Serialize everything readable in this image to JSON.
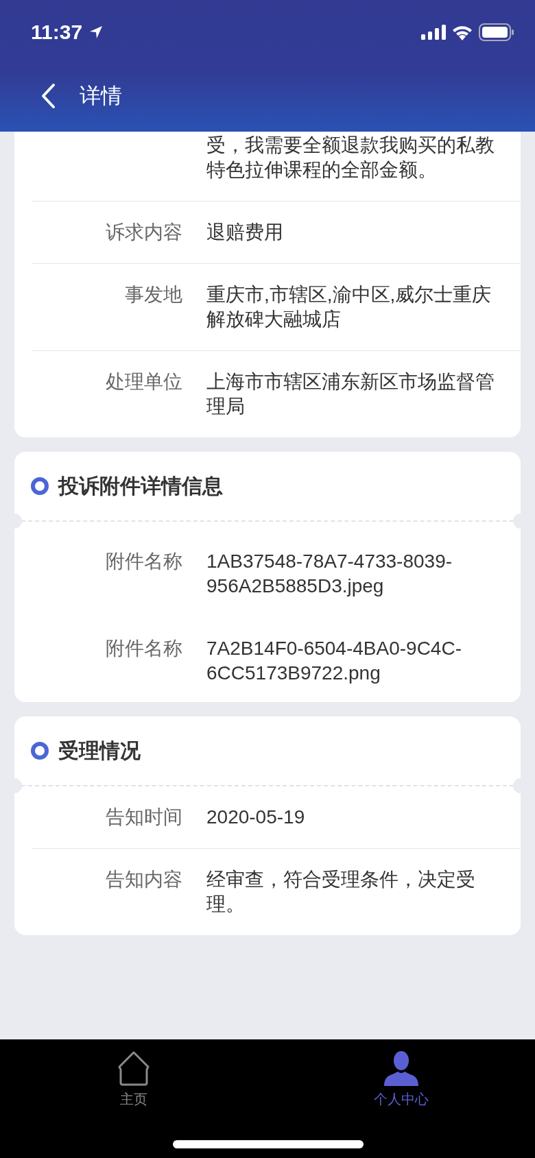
{
  "status_bar": {
    "time": "11:37"
  },
  "nav_bar": {
    "title": "详情"
  },
  "sections": [
    {
      "rows": [
        {
          "label": null,
          "value": "受，我需要全额退款我购买的私教特色拉伸课程的全部金额。"
        },
        {
          "label": "诉求内容",
          "value": "退赔费用"
        },
        {
          "label": "事发地",
          "value": "重庆市,市辖区,渝中区,威尔士重庆解放碑大融城店"
        },
        {
          "label": "处理单位",
          "value": "上海市市辖区浦东新区市场监督管理局"
        }
      ],
      "dividers": true
    },
    {
      "title": "投诉附件详情信息",
      "rows": [
        {
          "label": "附件名称",
          "value": "1AB37548-78A7-4733-8039-956A2B5885D3.jpeg"
        },
        {
          "label": "附件名称",
          "value": "7A2B14F0-6504-4BA0-9C4C-6CC5173B9722.png"
        }
      ],
      "dividers": false
    },
    {
      "title": "受理情况",
      "rows": [
        {
          "label": "告知时间",
          "value": "2020-05-19"
        },
        {
          "label": "告知内容",
          "value": "经审查，符合受理条件，决定受理。"
        }
      ],
      "dividers": true
    }
  ],
  "tab_bar": [
    {
      "kind": "home",
      "label": "主页",
      "selected": false
    },
    {
      "kind": "person",
      "label": "个人中心",
      "selected": true
    }
  ]
}
